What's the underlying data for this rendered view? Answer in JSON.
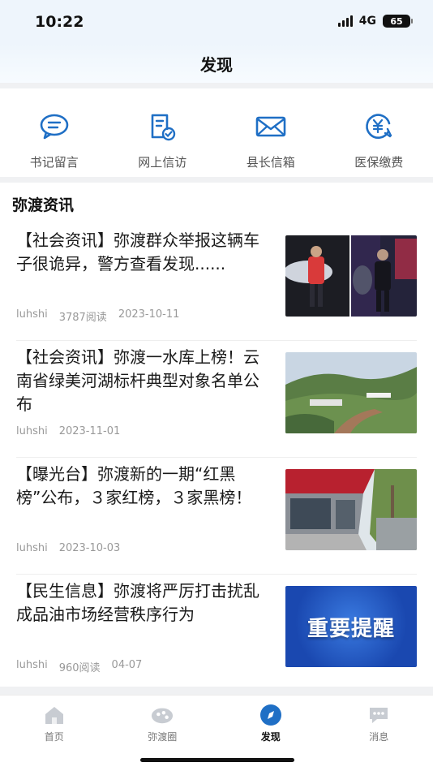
{
  "status": {
    "time": "10:22",
    "network": "4G",
    "battery": "65"
  },
  "header": {
    "title": "发现"
  },
  "quick_links": [
    {
      "label": "书记留言",
      "icon": "chat-bubble-icon"
    },
    {
      "label": "网上信访",
      "icon": "document-check-icon"
    },
    {
      "label": "县长信箱",
      "icon": "mail-icon"
    },
    {
      "label": "医保缴费",
      "icon": "yuan-payment-icon"
    }
  ],
  "section": {
    "title": "弥渡资讯"
  },
  "news": [
    {
      "title": "【社会资讯】弥渡群众举报这辆车子很诡异，警方查看发现......",
      "author": "luhshi",
      "reads": "3787阅读",
      "date": "2023-10-11"
    },
    {
      "title": "【社会资讯】弥渡一水库上榜！云南省绿美河湖标杆典型对象名单公布",
      "author": "luhshi",
      "reads": "",
      "date": "2023-11-01"
    },
    {
      "title": "【曝光台】弥渡新的一期“红黑榜”公布，３家红榜，３家黑榜！",
      "author": "luhshi",
      "reads": "",
      "date": "2023-10-03"
    },
    {
      "title": "【民生信息】弥渡将严厉打击扰乱成品油市场经营秩序行为",
      "author": "luhshi",
      "reads": "960阅读",
      "date": "04-07",
      "thumb_text": "重要提醒"
    }
  ],
  "tabs": [
    {
      "label": "首页",
      "icon": "home-icon"
    },
    {
      "label": "弥渡圈",
      "icon": "community-icon"
    },
    {
      "label": "发现",
      "icon": "compass-icon",
      "active": true
    },
    {
      "label": "消息",
      "icon": "message-icon"
    }
  ],
  "colors": {
    "accent": "#1f6fc5",
    "tab_inactive": "#c8ccd2"
  }
}
